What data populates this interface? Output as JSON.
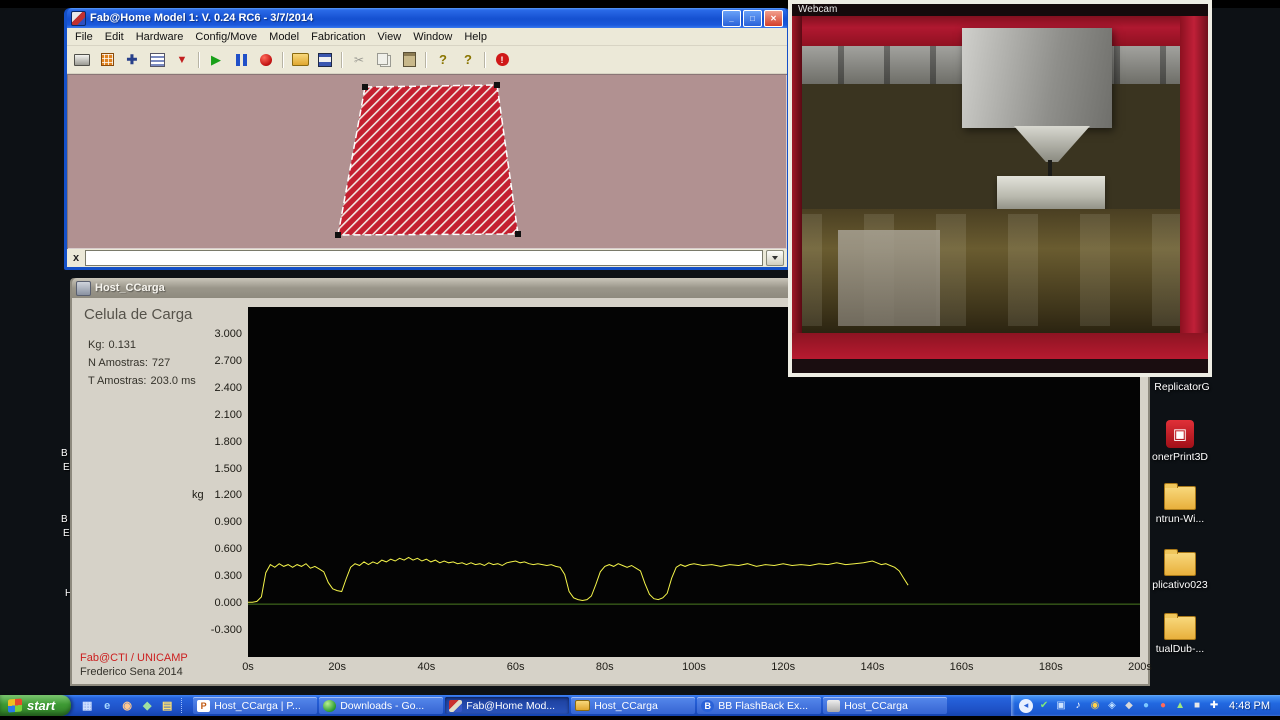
{
  "fab_window": {
    "title": "Fab@Home Model 1: V. 0.24 RC6 - 3/7/2014",
    "menu_items": [
      "File",
      "Edit",
      "Hardware",
      "Config/Move",
      "Model",
      "Fabrication",
      "View",
      "Window",
      "Help"
    ],
    "toolbar_icons": [
      "print",
      "fab-pad",
      "jog",
      "layers",
      "export",
      "play",
      "pause",
      "stop",
      "open",
      "save",
      "cut",
      "copy",
      "paste",
      "help",
      "context-help",
      "emergency-stop"
    ],
    "controls": [
      {
        "name": "minimize-button",
        "glyph": "_"
      },
      {
        "name": "maximize-button",
        "glyph": "□"
      },
      {
        "name": "close-button",
        "glyph": "✕"
      }
    ],
    "command_close": "x",
    "command_value": ""
  },
  "chart_window": {
    "title": "Host_CCarga",
    "heading": "Celula de Carga",
    "readouts": [
      {
        "label": "Kg:",
        "value": "0.131"
      },
      {
        "label": "N Amostras:",
        "value": "727"
      },
      {
        "label": "T Amostras:",
        "value": "203.0 ms"
      }
    ],
    "unit_label": "kg",
    "credit_line1": "Fab@CTI / UNICAMP",
    "credit_line2": "Frederico Sena 2014"
  },
  "chart_data": {
    "type": "line",
    "title": "Celula de Carga",
    "ylabel": "kg",
    "ylim": [
      -0.59,
      3.312
    ],
    "xlim": [
      0,
      200
    ],
    "grid": false,
    "yticks": [
      "3.000",
      "2.700",
      "2.400",
      "2.100",
      "1.800",
      "1.500",
      "1.200",
      "0.900",
      "0.600",
      "0.300",
      "0.000",
      "-0.300"
    ],
    "xticks": [
      "0s",
      "20s",
      "40s",
      "60s",
      "80s",
      "100s",
      "120s",
      "140s",
      "160s",
      "180s",
      "200s"
    ],
    "series": [
      {
        "name": "load-cell-kg",
        "color": "#f4f44a",
        "width": 1,
        "points": [
          [
            0,
            0.02
          ],
          [
            1,
            0.02
          ],
          [
            2,
            0.03
          ],
          [
            3,
            0.08
          ],
          [
            4,
            0.35
          ],
          [
            5,
            0.44
          ],
          [
            6,
            0.41
          ],
          [
            7,
            0.45
          ],
          [
            8,
            0.42
          ],
          [
            9,
            0.44
          ],
          [
            10,
            0.41
          ],
          [
            11,
            0.44
          ],
          [
            12,
            0.42
          ],
          [
            13,
            0.45
          ],
          [
            14,
            0.4
          ],
          [
            15,
            0.42
          ],
          [
            16,
            0.39
          ],
          [
            17,
            0.36
          ],
          [
            18,
            0.24
          ],
          [
            19,
            0.17
          ],
          [
            20,
            0.15
          ],
          [
            21,
            0.14
          ],
          [
            22,
            0.28
          ],
          [
            23,
            0.41
          ],
          [
            24,
            0.45
          ],
          [
            25,
            0.43
          ],
          [
            26,
            0.47
          ],
          [
            27,
            0.44
          ],
          [
            28,
            0.47
          ],
          [
            29,
            0.45
          ],
          [
            30,
            0.49
          ],
          [
            31,
            0.47
          ],
          [
            32,
            0.5
          ],
          [
            33,
            0.48
          ],
          [
            34,
            0.51
          ],
          [
            35,
            0.49
          ],
          [
            36,
            0.52
          ],
          [
            37,
            0.49
          ],
          [
            38,
            0.51
          ],
          [
            39,
            0.48
          ],
          [
            40,
            0.5
          ],
          [
            41,
            0.47
          ],
          [
            42,
            0.49
          ],
          [
            43,
            0.46
          ],
          [
            44,
            0.48
          ],
          [
            45,
            0.46
          ],
          [
            46,
            0.47
          ],
          [
            47,
            0.45
          ],
          [
            48,
            0.46
          ],
          [
            49,
            0.44
          ],
          [
            50,
            0.46
          ],
          [
            51,
            0.44
          ],
          [
            52,
            0.45
          ],
          [
            53,
            0.43
          ],
          [
            54,
            0.46
          ],
          [
            55,
            0.44
          ],
          [
            56,
            0.45
          ],
          [
            57,
            0.43
          ],
          [
            58,
            0.46
          ],
          [
            59,
            0.47
          ],
          [
            60,
            0.48
          ],
          [
            61,
            0.46
          ],
          [
            62,
            0.47
          ],
          [
            63,
            0.45
          ],
          [
            64,
            0.44
          ],
          [
            65,
            0.45
          ],
          [
            66,
            0.44
          ],
          [
            67,
            0.43
          ],
          [
            68,
            0.44
          ],
          [
            69,
            0.42
          ],
          [
            70,
            0.41
          ],
          [
            71,
            0.33
          ],
          [
            72,
            0.14
          ],
          [
            73,
            0.07
          ],
          [
            74,
            0.05
          ],
          [
            75,
            0.04
          ],
          [
            76,
            0.05
          ],
          [
            77,
            0.09
          ],
          [
            78,
            0.22
          ],
          [
            79,
            0.36
          ],
          [
            80,
            0.42
          ],
          [
            81,
            0.44
          ],
          [
            82,
            0.42
          ],
          [
            83,
            0.45
          ],
          [
            84,
            0.43
          ],
          [
            85,
            0.41
          ],
          [
            86,
            0.43
          ],
          [
            87,
            0.4
          ],
          [
            88,
            0.37
          ],
          [
            89,
            0.23
          ],
          [
            90,
            0.11
          ],
          [
            91,
            0.06
          ],
          [
            92,
            0.05
          ],
          [
            93,
            0.07
          ],
          [
            94,
            0.12
          ],
          [
            95,
            0.29
          ],
          [
            96,
            0.41
          ],
          [
            97,
            0.44
          ],
          [
            98,
            0.42
          ],
          [
            99,
            0.44
          ],
          [
            100,
            0.45
          ],
          [
            102,
            0.43
          ],
          [
            104,
            0.44
          ],
          [
            106,
            0.42
          ],
          [
            108,
            0.44
          ],
          [
            110,
            0.43
          ],
          [
            112,
            0.45
          ],
          [
            114,
            0.42
          ],
          [
            116,
            0.44
          ],
          [
            118,
            0.43
          ],
          [
            120,
            0.45
          ],
          [
            122,
            0.43
          ],
          [
            124,
            0.44
          ],
          [
            126,
            0.43
          ],
          [
            128,
            0.45
          ],
          [
            130,
            0.44
          ],
          [
            132,
            0.46
          ],
          [
            134,
            0.44
          ],
          [
            136,
            0.45
          ],
          [
            138,
            0.46
          ],
          [
            140,
            0.48
          ],
          [
            141,
            0.46
          ],
          [
            142,
            0.44
          ],
          [
            143,
            0.45
          ],
          [
            144,
            0.43
          ],
          [
            145,
            0.41
          ],
          [
            146,
            0.37
          ],
          [
            147,
            0.29
          ],
          [
            148,
            0.21
          ]
        ]
      },
      {
        "name": "zero-baseline",
        "color": "#4a7a20",
        "width": 1,
        "points": [
          [
            0,
            0.0
          ],
          [
            200,
            0.0
          ]
        ]
      }
    ]
  },
  "webcam_window": {
    "title": "Webcam"
  },
  "desktop": {
    "right_icons": [
      {
        "name": "replicatorg",
        "label": "ReplicatorG",
        "type": "label-only"
      },
      {
        "name": "zonerprint3d",
        "label": "onerPrint3D",
        "type": "app-red"
      },
      {
        "name": "folder-printrun",
        "label": "ntrun-Wi...",
        "type": "folder"
      },
      {
        "name": "folder-aplicativo",
        "label": "plicativo023",
        "type": "folder"
      },
      {
        "name": "folder-virtualdub",
        "label": "tualDub-...",
        "type": "folder"
      }
    ],
    "left_fragments": [
      "B",
      "E",
      "B",
      "E",
      "H"
    ]
  },
  "taskbar": {
    "start_label": "start",
    "quick_launch": [
      {
        "name": "show-desktop-icon",
        "glyph": "▦",
        "color": "#cfe0ff"
      },
      {
        "name": "internet-explorer-icon",
        "glyph": "e",
        "color": "#a8d8ff"
      },
      {
        "name": "media-player-icon",
        "glyph": "◉",
        "color": "#ffc890"
      },
      {
        "name": "messenger-icon",
        "glyph": "◆",
        "color": "#9fe0a0"
      },
      {
        "name": "explorer-icon",
        "glyph": "▤",
        "color": "#ffe070"
      }
    ],
    "tasks": [
      {
        "label": "Host_CCarga | P...",
        "icon": "doc",
        "icon_text": "P",
        "active": false
      },
      {
        "label": "Downloads - Go...",
        "icon": "globe",
        "icon_text": "",
        "active": false
      },
      {
        "label": "Fab@Home Mod...",
        "icon": "fab",
        "icon_text": "",
        "active": true
      },
      {
        "label": "Host_CCarga",
        "icon": "folder",
        "icon_text": "",
        "active": false
      },
      {
        "label": "BB FlashBack Ex...",
        "icon": "bb",
        "icon_text": "B",
        "active": false
      },
      {
        "label": "Host_CCarga",
        "icon": "app",
        "icon_text": "",
        "active": false
      }
    ],
    "tray_icons": [
      {
        "name": "antivirus-icon",
        "glyph": "✔",
        "color": "#7ee87e"
      },
      {
        "name": "display-icon",
        "glyph": "▣",
        "color": "#cfe4ff"
      },
      {
        "name": "volume-icon",
        "glyph": "♪",
        "color": "#ffffff"
      },
      {
        "name": "update-icon",
        "glyph": "◉",
        "color": "#ffd24a"
      },
      {
        "name": "network-icon",
        "glyph": "◈",
        "color": "#bfe0ff"
      },
      {
        "name": "usb-icon",
        "glyph": "◆",
        "color": "#d8d8d8"
      },
      {
        "name": "messenger-tray-icon",
        "glyph": "●",
        "color": "#7ec8ff"
      },
      {
        "name": "alert-icon",
        "glyph": "●",
        "color": "#ff6a5a"
      },
      {
        "name": "scheduler-icon",
        "glyph": "▲",
        "color": "#9fe87e"
      },
      {
        "name": "battery-icon",
        "glyph": "■",
        "color": "#e8e8e8"
      },
      {
        "name": "sync-icon",
        "glyph": "✚",
        "color": "#ffffff"
      }
    ],
    "clock": "4:48 PM"
  }
}
